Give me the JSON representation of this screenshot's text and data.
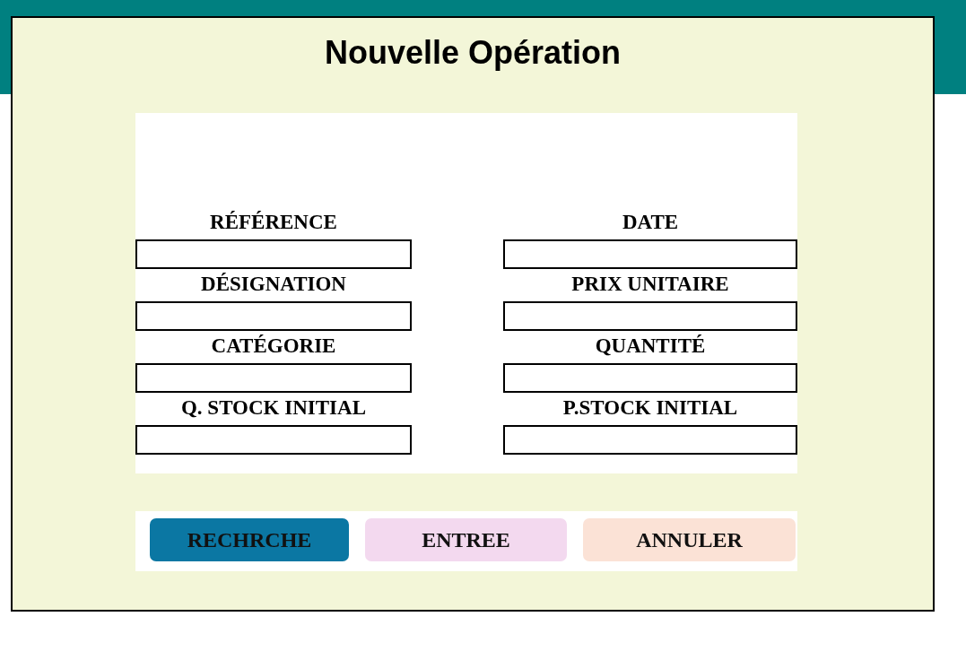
{
  "window": {
    "title": "Nouvelle Opération"
  },
  "form": {
    "columns": [
      {
        "fields": [
          {
            "label": "RÉFÉRENCE"
          },
          {
            "label": "DÉSIGNATION"
          },
          {
            "label": "CATÉGORIE"
          },
          {
            "label": "Q. STOCK INITIAL"
          }
        ]
      },
      {
        "fields": [
          {
            "label": "DATE"
          },
          {
            "label": "PRIX UNITAIRE"
          },
          {
            "label": "QUANTITÉ"
          },
          {
            "label": "P.STOCK INITIAL"
          }
        ]
      }
    ]
  },
  "buttons": [
    {
      "label": "RECHRCHE",
      "color": "#0b77a3"
    },
    {
      "label": "ENTREE",
      "color": "#f3d9ef"
    },
    {
      "label": "ANNULER",
      "color": "#fbe2d6"
    }
  ]
}
